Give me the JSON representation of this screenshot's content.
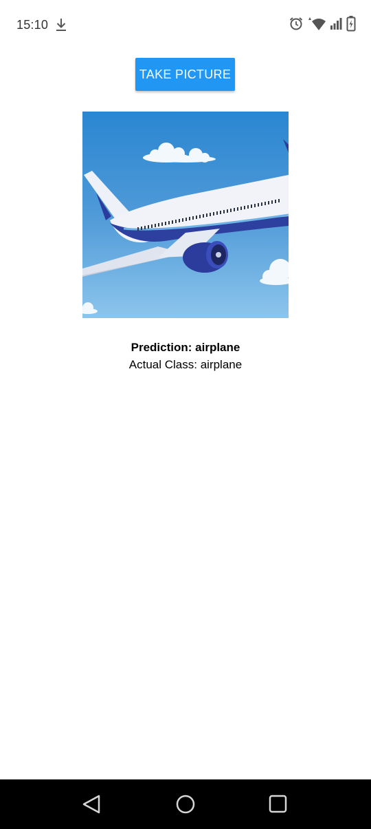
{
  "status_bar": {
    "time": "15:10",
    "left_icons": [
      "download-icon"
    ],
    "right_icons": [
      "alarm-icon",
      "wifi-icon",
      "cell-signal-icon",
      "battery-charging-icon"
    ]
  },
  "main": {
    "take_picture_label": "TAKE PICTURE",
    "button_color": "#2196f3",
    "image": {
      "subject": "airplane",
      "icon": "airplane-photo"
    },
    "prediction_text": "Prediction: airplane",
    "actual_class_text": "Actual Class: airplane"
  },
  "nav_bar": {
    "buttons": [
      "back-icon",
      "home-icon",
      "recents-icon"
    ]
  }
}
